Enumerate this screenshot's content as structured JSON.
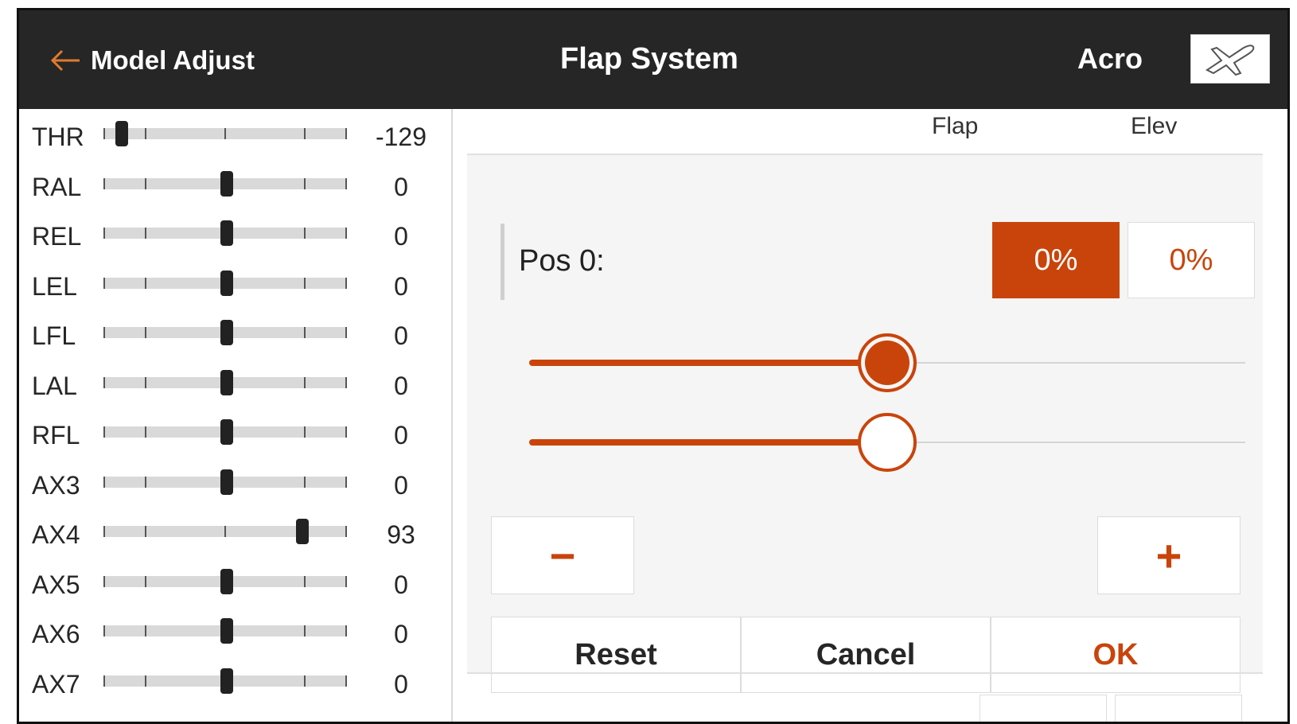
{
  "header": {
    "back_label": "Model Adjust",
    "title": "Flap System",
    "model_type": "Acro",
    "model_icon": "airplane-icon"
  },
  "channels": [
    {
      "name": "THR",
      "value": "-129",
      "position": -129
    },
    {
      "name": "RAL",
      "value": "0",
      "position": 0
    },
    {
      "name": "REL",
      "value": "0",
      "position": 0
    },
    {
      "name": "LEL",
      "value": "0",
      "position": 0
    },
    {
      "name": "LFL",
      "value": "0",
      "position": 0
    },
    {
      "name": "LAL",
      "value": "0",
      "position": 0
    },
    {
      "name": "RFL",
      "value": "0",
      "position": 0
    },
    {
      "name": "AX3",
      "value": "0",
      "position": 0
    },
    {
      "name": "AX4",
      "value": "93",
      "position": 93
    },
    {
      "name": "AX5",
      "value": "0",
      "position": 0
    },
    {
      "name": "AX6",
      "value": "0",
      "position": 0
    },
    {
      "name": "AX7",
      "value": "0",
      "position": 0
    }
  ],
  "columns": {
    "flap": "Flap",
    "elev": "Elev"
  },
  "editor": {
    "position_label": "Pos 0:",
    "flap_value": "0%",
    "elev_value": "0%",
    "minus_label": "−",
    "plus_label": "+",
    "flap_slider_fraction": 0.5,
    "elev_slider_fraction": 0.5
  },
  "actions": {
    "reset": "Reset",
    "cancel": "Cancel",
    "ok": "OK"
  },
  "colors": {
    "accent": "#c9440b",
    "header_bg": "#262626",
    "panel_bg": "#f5f5f5"
  }
}
